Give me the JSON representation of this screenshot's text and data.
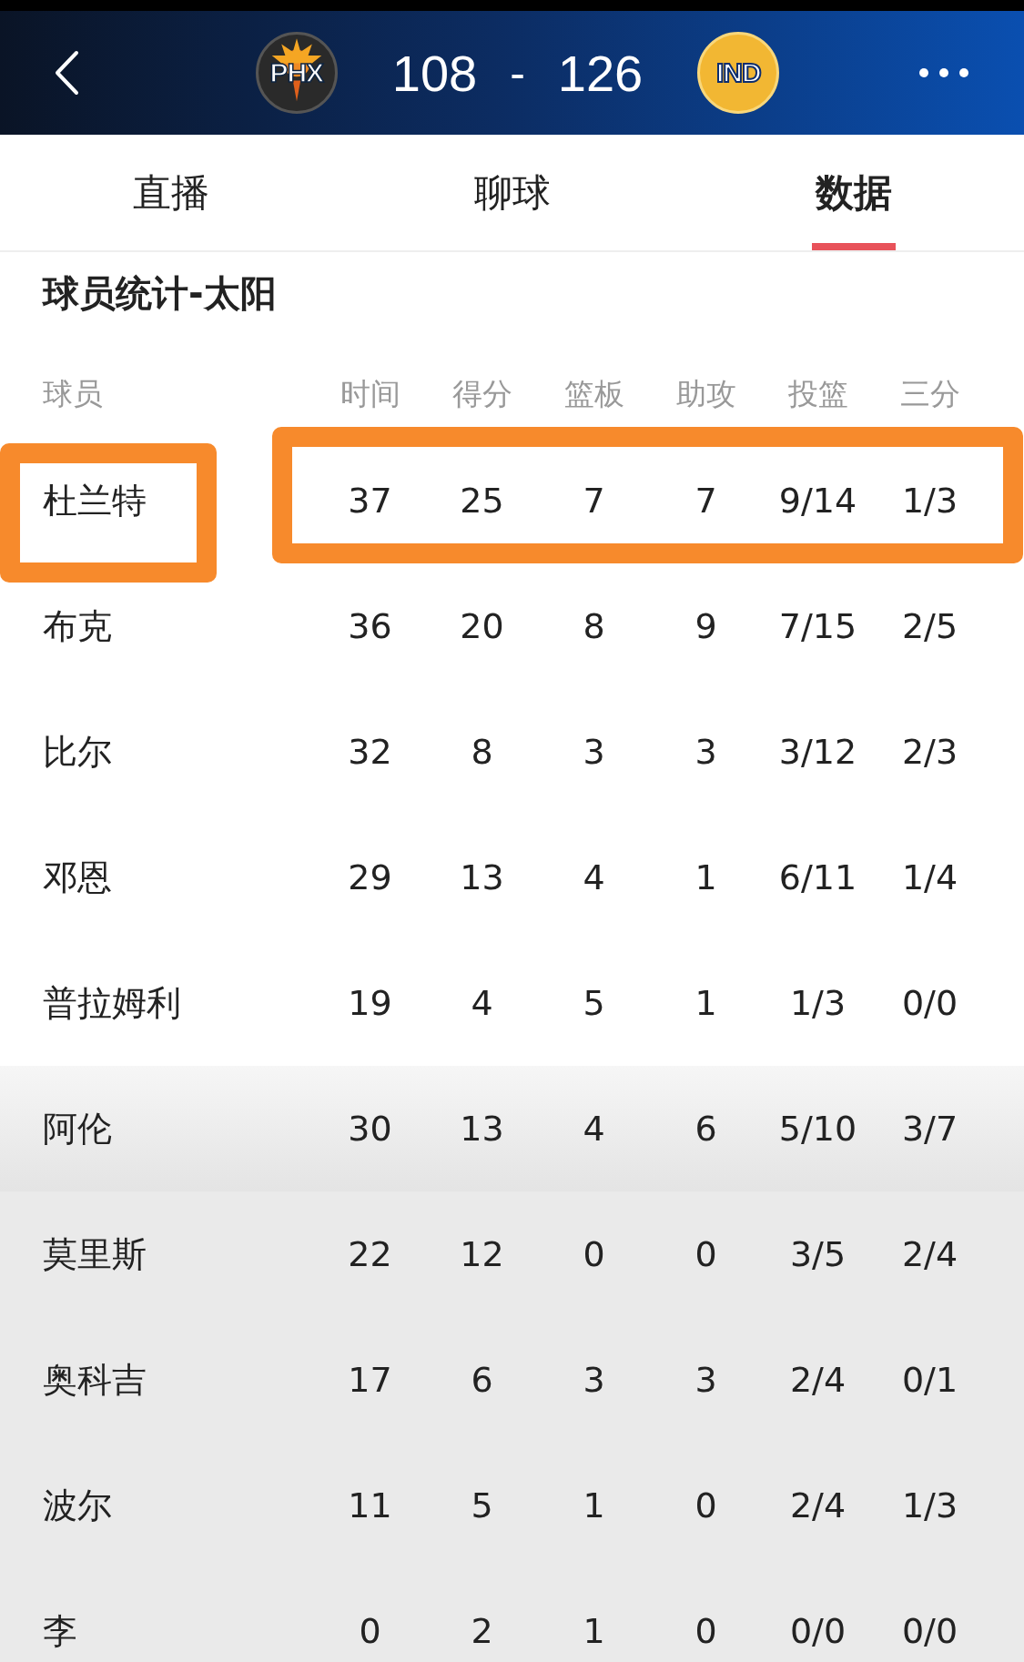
{
  "header": {
    "home_team": {
      "abbr": "PHX"
    },
    "away_team": {
      "abbr": "IND"
    },
    "home_score": "108",
    "separator": "-",
    "away_score": "126"
  },
  "tabs": [
    {
      "label": "直播",
      "selected": false
    },
    {
      "label": "聊球",
      "selected": false
    },
    {
      "label": "数据",
      "selected": true
    }
  ],
  "section_title": "球员统计-太阳",
  "columns": [
    "球员",
    "时间",
    "得分",
    "篮板",
    "助攻",
    "投篮",
    "三分"
  ],
  "players": [
    {
      "name": "杜兰特",
      "stats": [
        "37",
        "25",
        "7",
        "7",
        "9/14",
        "1/3"
      ],
      "starter": true,
      "highlighted": true
    },
    {
      "name": "布克",
      "stats": [
        "36",
        "20",
        "8",
        "9",
        "7/15",
        "2/5"
      ],
      "starter": true,
      "highlighted": false
    },
    {
      "name": "比尔",
      "stats": [
        "32",
        "8",
        "3",
        "3",
        "3/12",
        "2/3"
      ],
      "starter": true,
      "highlighted": false
    },
    {
      "name": "邓恩",
      "stats": [
        "29",
        "13",
        "4",
        "1",
        "6/11",
        "1/4"
      ],
      "starter": true,
      "highlighted": false
    },
    {
      "name": "普拉姆利",
      "stats": [
        "19",
        "4",
        "5",
        "1",
        "1/3",
        "0/0"
      ],
      "starter": true,
      "highlighted": false
    },
    {
      "name": "阿伦",
      "stats": [
        "30",
        "13",
        "4",
        "6",
        "5/10",
        "3/7"
      ],
      "starter": false,
      "highlighted": false
    },
    {
      "name": "莫里斯",
      "stats": [
        "22",
        "12",
        "0",
        "0",
        "3/5",
        "2/4"
      ],
      "starter": false,
      "highlighted": false
    },
    {
      "name": "奥科吉",
      "stats": [
        "17",
        "6",
        "3",
        "3",
        "2/4",
        "0/1"
      ],
      "starter": false,
      "highlighted": false
    },
    {
      "name": "波尔",
      "stats": [
        "11",
        "5",
        "1",
        "0",
        "2/4",
        "1/3"
      ],
      "starter": false,
      "highlighted": false
    },
    {
      "name": "李",
      "stats": [
        "0",
        "2",
        "1",
        "0",
        "0/0",
        "0/0"
      ],
      "starter": false,
      "highlighted": false
    }
  ]
}
